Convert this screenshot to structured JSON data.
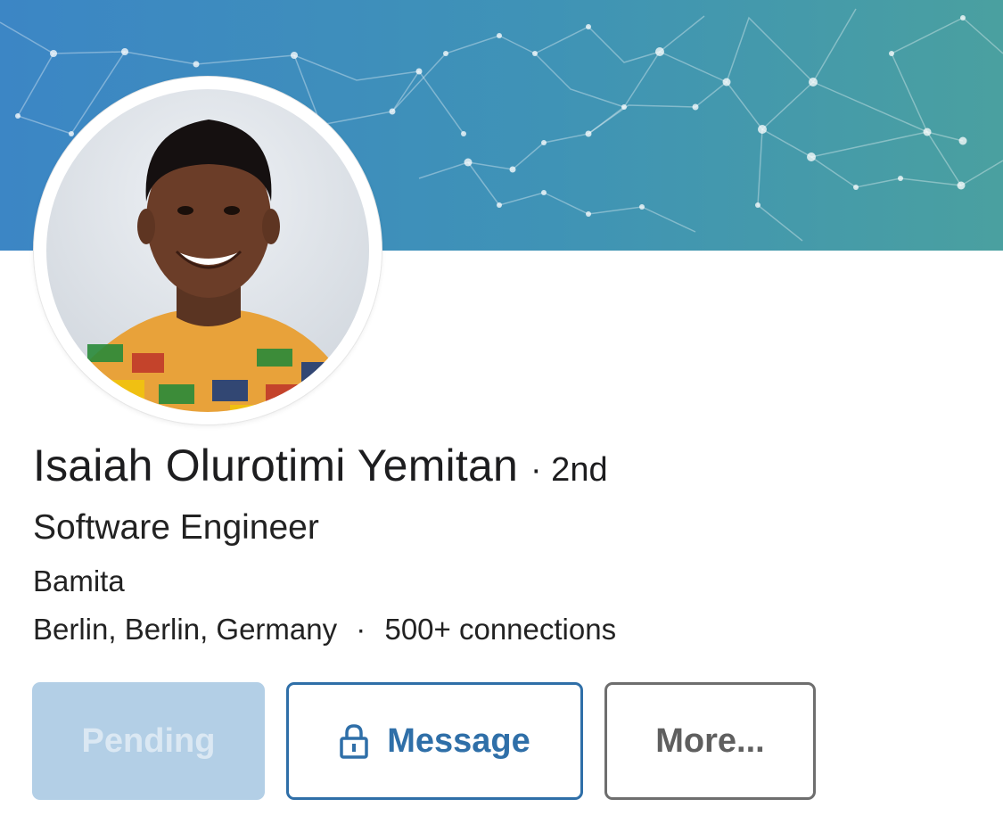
{
  "profile": {
    "name": "Isaiah Olurotimi Yemitan",
    "degree": "· 2nd",
    "headline": "Software Engineer",
    "company": "Bamita",
    "location": "Berlin, Berlin, Germany",
    "separator": "·",
    "connections": "500+ connections"
  },
  "actions": {
    "pending_label": "Pending",
    "message_label": "Message",
    "more_label": "More..."
  },
  "icons": {
    "message_icon": "lock-icon"
  },
  "colors": {
    "banner_start": "#3d87c4",
    "banner_end": "#4a9fa0",
    "primary": "#2f6fa8",
    "pending_bg": "#b3cfe6",
    "more_border": "#6e6e6e"
  }
}
